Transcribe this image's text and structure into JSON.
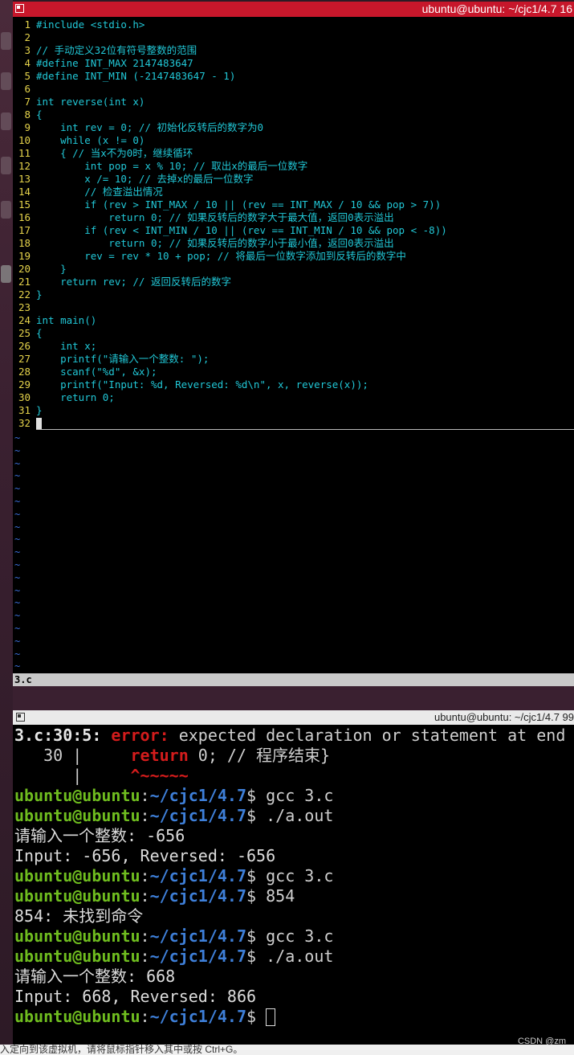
{
  "editor": {
    "title": "ubuntu@ubuntu: ~/cjc1/4.7 16",
    "lines": [
      {
        "n": "1",
        "t": "#include <stdio.h>"
      },
      {
        "n": "2",
        "t": ""
      },
      {
        "n": "3",
        "t": "// 手动定义32位有符号整数的范围"
      },
      {
        "n": "4",
        "t": "#define INT_MAX 2147483647"
      },
      {
        "n": "5",
        "t": "#define INT_MIN (-2147483647 - 1)"
      },
      {
        "n": "6",
        "t": ""
      },
      {
        "n": "7",
        "t": "int reverse(int x)"
      },
      {
        "n": "8",
        "t": "{"
      },
      {
        "n": "9",
        "t": "    int rev = 0; // 初始化反转后的数字为0"
      },
      {
        "n": "10",
        "t": "    while (x != 0)"
      },
      {
        "n": "11",
        "t": "    { // 当x不为0时，继续循环"
      },
      {
        "n": "12",
        "t": "        int pop = x % 10; // 取出x的最后一位数字"
      },
      {
        "n": "13",
        "t": "        x /= 10; // 去掉x的最后一位数字"
      },
      {
        "n": "14",
        "t": "        // 检查溢出情况"
      },
      {
        "n": "15",
        "t": "        if (rev > INT_MAX / 10 || (rev == INT_MAX / 10 && pop > 7))"
      },
      {
        "n": "16",
        "t": "            return 0; // 如果反转后的数字大于最大值，返回0表示溢出"
      },
      {
        "n": "17",
        "t": "        if (rev < INT_MIN / 10 || (rev == INT_MIN / 10 && pop < -8))"
      },
      {
        "n": "18",
        "t": "            return 0; // 如果反转后的数字小于最小值，返回0表示溢出"
      },
      {
        "n": "19",
        "t": "        rev = rev * 10 + pop; // 将最后一位数字添加到反转后的数字中"
      },
      {
        "n": "20",
        "t": "    }"
      },
      {
        "n": "21",
        "t": "    return rev; // 返回反转后的数字"
      },
      {
        "n": "22",
        "t": "}"
      },
      {
        "n": "23",
        "t": ""
      },
      {
        "n": "24",
        "t": "int main()"
      },
      {
        "n": "25",
        "t": "{"
      },
      {
        "n": "26",
        "t": "    int x;"
      },
      {
        "n": "27",
        "t": "    printf(\"请输入一个整数: \");"
      },
      {
        "n": "28",
        "t": "    scanf(\"%d\", &x);"
      },
      {
        "n": "29",
        "t": "    printf(\"Input: %d, Reversed: %d\\n\", x, reverse(x));"
      },
      {
        "n": "30",
        "t": "    return 0;"
      },
      {
        "n": "31",
        "t": "}"
      },
      {
        "n": "32",
        "t": ""
      }
    ],
    "tilde": "~",
    "status_file": "3.c"
  },
  "terminal": {
    "title": "ubuntu@ubuntu: ~/cjc1/4.7 99",
    "error_loc": "3.c:30:5:",
    "error_word": "error:",
    "error_msg": " expected declaration or statement at end of",
    "src_lineno": "   30 |     ",
    "src_kw": "return",
    "src_rest": " 0; // 程序结束}",
    "caret_prefix": "      |     ",
    "caret": "^~~~~~",
    "user": "ubuntu@ubuntu",
    "colon": ":",
    "path": "~/cjc1/4.7",
    "dollar": "$ ",
    "cmd1": "gcc 3.c",
    "cmd2": "./a.out",
    "out1": "请输入一个整数: -656",
    "out2": "Input: -656, Reversed: -656",
    "cmd3": "gcc 3.c",
    "cmd4": "854",
    "out3": "854: 未找到命令",
    "cmd5": "gcc 3.c",
    "cmd6": "./a.out",
    "out4": "请输入一个整数: 668",
    "out5": "Input: 668, Reversed: 866"
  },
  "bottom_text": "入定向到该虚拟机，请将鼠标指针移入其中或按 Ctrl+G。",
  "watermark": "CSDN @zm"
}
